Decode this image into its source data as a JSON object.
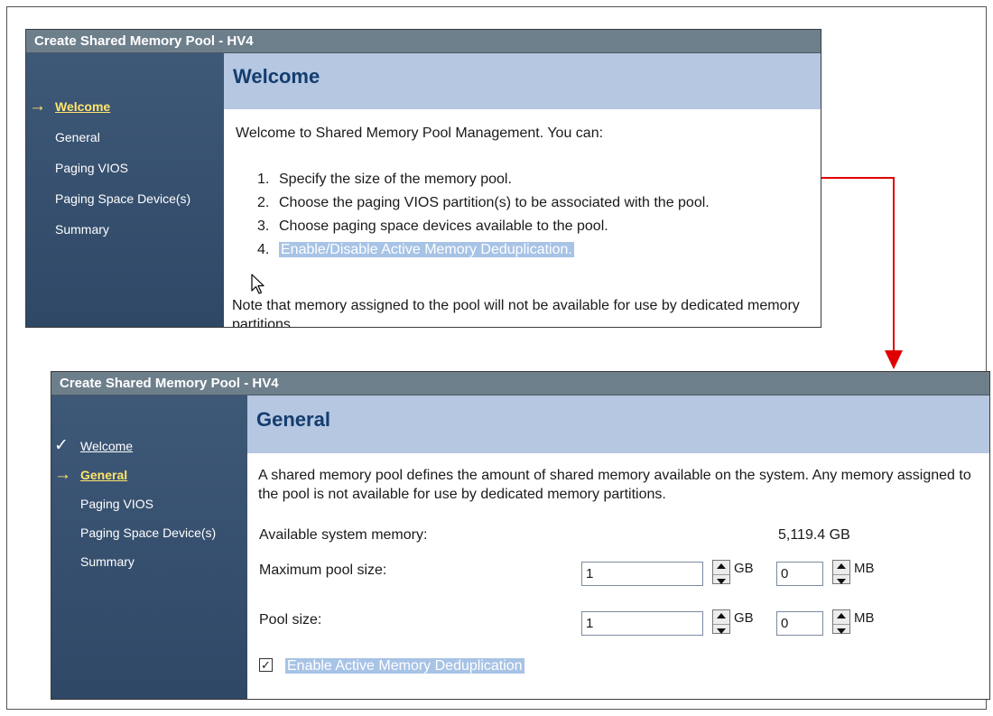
{
  "window1": {
    "title": "Create Shared Memory Pool - HV4",
    "nav": [
      {
        "label": "Welcome",
        "state": "current"
      },
      {
        "label": "General",
        "state": "pending"
      },
      {
        "label": "Paging VIOS",
        "state": "pending"
      },
      {
        "label": "Paging Space Device(s)",
        "state": "pending"
      },
      {
        "label": "Summary",
        "state": "pending"
      }
    ],
    "heading": "Welcome",
    "intro": "Welcome to Shared Memory Pool Management. You can:",
    "steps": [
      {
        "num": "1.",
        "text": "Specify the size of the memory pool."
      },
      {
        "num": "2.",
        "text": "Choose the paging VIOS partition(s) to be associated with the pool."
      },
      {
        "num": "3.",
        "text": "Choose paging space devices available to the pool."
      },
      {
        "num": "4.",
        "text": "Enable/Disable Active Memory Deduplication."
      }
    ],
    "note": "Note that memory assigned to the pool will not be available for use by dedicated memory partitions."
  },
  "window2": {
    "title": "Create Shared Memory Pool - HV4",
    "nav": [
      {
        "label": "Welcome",
        "state": "done"
      },
      {
        "label": "General",
        "state": "current"
      },
      {
        "label": "Paging VIOS",
        "state": "pending"
      },
      {
        "label": "Paging Space Device(s)",
        "state": "pending"
      },
      {
        "label": "Summary",
        "state": "pending"
      }
    ],
    "heading": "General",
    "description": "A shared memory pool defines the amount of shared memory available on the system. Any memory assigned to the pool is not available for use by dedicated memory partitions.",
    "available_label": "Available system memory:",
    "available_value": "5,119.4 GB",
    "max_pool": {
      "label": "Maximum pool size:",
      "gb_value": "1",
      "gb_unit": "GB",
      "mb_value": "0",
      "mb_unit": "MB"
    },
    "pool": {
      "label": "Pool size:",
      "gb_value": "1",
      "gb_unit": "GB",
      "mb_value": "0",
      "mb_unit": "MB"
    },
    "dedup_checkbox": {
      "label": "Enable Active Memory Deduplication",
      "checked": true
    }
  },
  "markers": {
    "arrow": "→",
    "check": "✓",
    "checkmark_box": "✓"
  },
  "colors": {
    "connector": "#e00000",
    "nav_current": "#ffe56b",
    "heading_bg": "#b5c7e1",
    "highlight": "#a7c3e6"
  }
}
